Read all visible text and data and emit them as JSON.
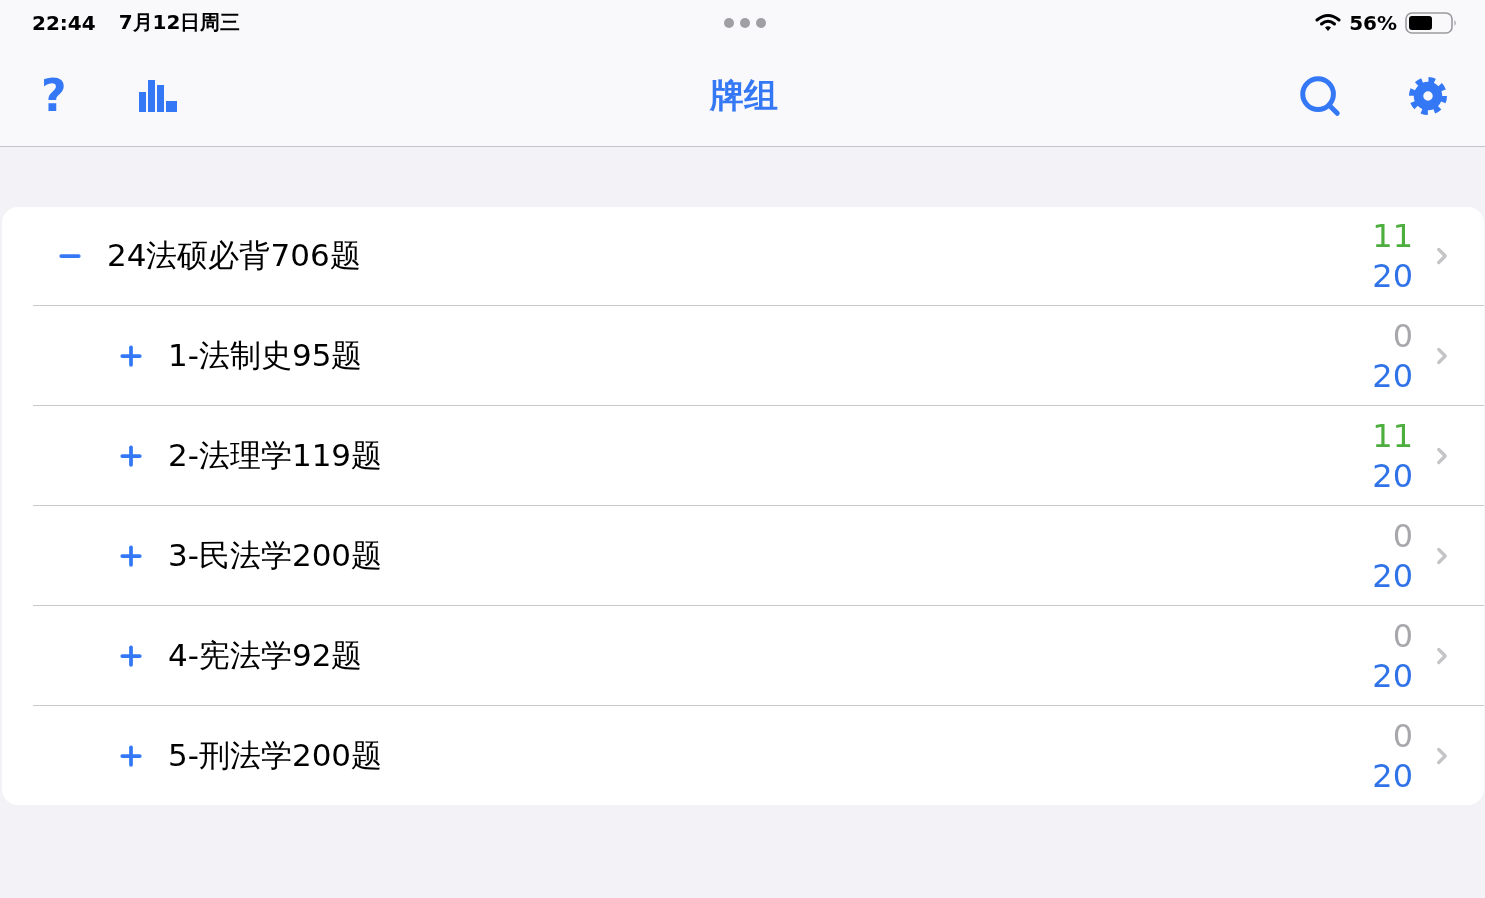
{
  "status_bar": {
    "time": "22:44",
    "date": "7月12日周三",
    "battery": "56%"
  },
  "nav_bar": {
    "help_button": "?",
    "title": "牌组"
  },
  "decks": [
    {
      "title": "24法硕必背706题",
      "expanded": true,
      "counts": [
        {
          "value": "11",
          "color": "#4cae3c"
        },
        {
          "value": "20",
          "color": "#3073e8"
        }
      ],
      "children": [
        {
          "title": "1-法制史95题",
          "expanded": false,
          "counts": [
            {
              "value": "0",
              "color": "#a8a8ac"
            },
            {
              "value": "20",
              "color": "#3073e8"
            }
          ]
        },
        {
          "title": "2-法理学119题",
          "expanded": false,
          "counts": [
            {
              "value": "11",
              "color": "#4cae3c"
            },
            {
              "value": "20",
              "color": "#3073e8"
            }
          ]
        },
        {
          "title": "3-民法学200题",
          "expanded": false,
          "counts": [
            {
              "value": "0",
              "color": "#a8a8ac"
            },
            {
              "value": "20",
              "color": "#3073e8"
            }
          ]
        },
        {
          "title": "4-宪法学92题",
          "expanded": false,
          "counts": [
            {
              "value": "0",
              "color": "#a8a8ac"
            },
            {
              "value": "20",
              "color": "#3073e8"
            }
          ]
        },
        {
          "title": "5-刑法学200题",
          "expanded": false,
          "counts": [
            {
              "value": "0",
              "color": "#a8a8ac"
            },
            {
              "value": "20",
              "color": "#3073e8"
            }
          ]
        }
      ]
    }
  ]
}
